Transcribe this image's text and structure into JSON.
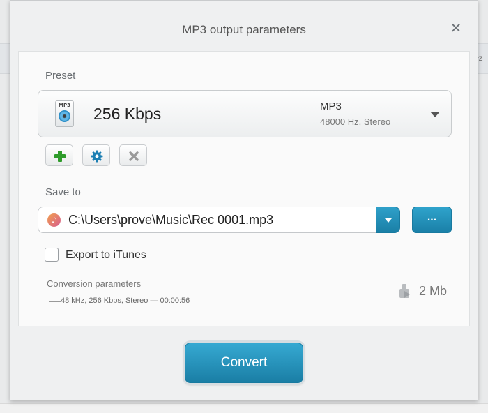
{
  "window": {
    "title": "MP3 output parameters",
    "close_glyph": "✕"
  },
  "background": {
    "right_edge_text": "łz"
  },
  "preset": {
    "label": "Preset",
    "icon_tag": "MP3",
    "name": "256 Kbps",
    "format": "MP3",
    "details": "48000 Hz,  Stereo"
  },
  "preset_actions": [
    {
      "name": "add-preset-button",
      "icon": "plus-icon"
    },
    {
      "name": "settings-preset-button",
      "icon": "gear-icon"
    },
    {
      "name": "delete-preset-button",
      "icon": "x-icon"
    }
  ],
  "save_to": {
    "label": "Save to",
    "path": "C:\\Users\\prove\\Music\\Rec 0001.mp3",
    "path_icon": "music-note-icon",
    "path_icon_glyph": "♪",
    "browse_label": "..."
  },
  "export": {
    "label": "Export to iTunes",
    "checked": false
  },
  "conversion": {
    "title": "Conversion parameters",
    "details": "48 kHz, 256 Kbps, Stereo — 00:00:56",
    "size": "2 Mb"
  },
  "convert_label": "Convert",
  "colors": {
    "accent": "#1f8db8",
    "plus_green": "#2e9b2a",
    "gear_blue": "#1c7fb3",
    "x_gray": "#9a9a9a"
  }
}
